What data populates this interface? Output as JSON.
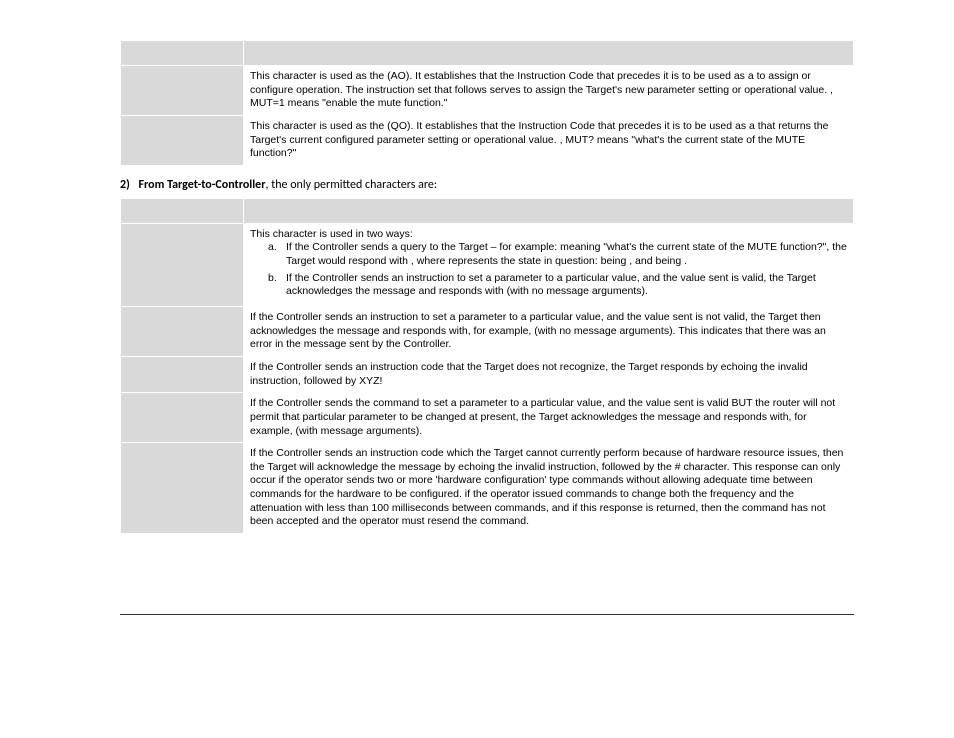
{
  "table1": {
    "r1_t1": "This character is used as the ",
    "r1_t2": " (AO). It establishes that the Instruction Code that precedes it is to be used as a ",
    "r1_t3": " to assign or configure operation. The instruction set that follows serves to assign the Target's new parameter setting or operational value. ",
    "r1_t4": ", MUT=1 means \"enable the mute function.\"",
    "r2_t1": "This character is used as the ",
    "r2_t2": " (QO). It establishes that the Instruction Code that precedes it is to be used as a ",
    "r2_t3": " that returns the Target's current configured parameter setting or operational value. ",
    "r2_t4": ", MUT? means \"what's the current state of the MUTE function?\""
  },
  "section2": {
    "num": "2)",
    "bold": "From Target-to-Controller",
    "rest": ", the only permitted characters are:"
  },
  "table2": {
    "r1_intro": "This character is used in two ways:",
    "r1_a_1": "If the Controller sends a query to the Target – for example: ",
    "r1_a_2": " meaning \"what's the current state of the MUTE function?\", the Target would respond with ",
    "r1_a_3": ", where ",
    "r1_a_4": " represents the state in question: ",
    "r1_a_5": " being ",
    "r1_a_6": ", and ",
    "r1_a_7": " being ",
    "r1_a_8": ".",
    "r1_b_1": "If the Controller sends an instruction to set a parameter to a particular value, and the value sent is valid, the Target acknowledges the message and responds with ",
    "r1_b_2": " (with no message arguments).",
    "r2_1": "If the Controller sends an instruction to set a parameter to a particular value, and the value sent is not valid, the Target then acknowledges the message and responds with, for example, ",
    "r2_2": " (with no message arguments). This indicates that there was an error in the message sent by the Controller.",
    "r3_1": "If the Controller sends an instruction code that the Target does not recognize, the Target responds by echoing the invalid instruction, followed by ",
    "r3_2": " XYZ!",
    "r4_1": "If the Controller sends the command to set a parameter to a particular value, and the value sent is valid BUT the router will not permit that particular parameter to be changed at present, the Target acknowledges the message and responds with, for example, ",
    "r4_2": " (with message arguments).",
    "r5_1": "If the Controller sends an instruction code which the Target cannot currently perform because of hardware resource issues, then the Target will acknowledge the message by echoing the invalid instruction, followed by the # character. This response can only occur if the operator sends two or more 'hardware configuration' type commands without allowing adequate time between commands for the hardware to be configured. ",
    "r5_2": " if the operator issued commands to change both the frequency and the attenuation with less than 100 milliseconds between commands, and if this response is returned, then the command has not been accepted and the operator must resend the command."
  }
}
